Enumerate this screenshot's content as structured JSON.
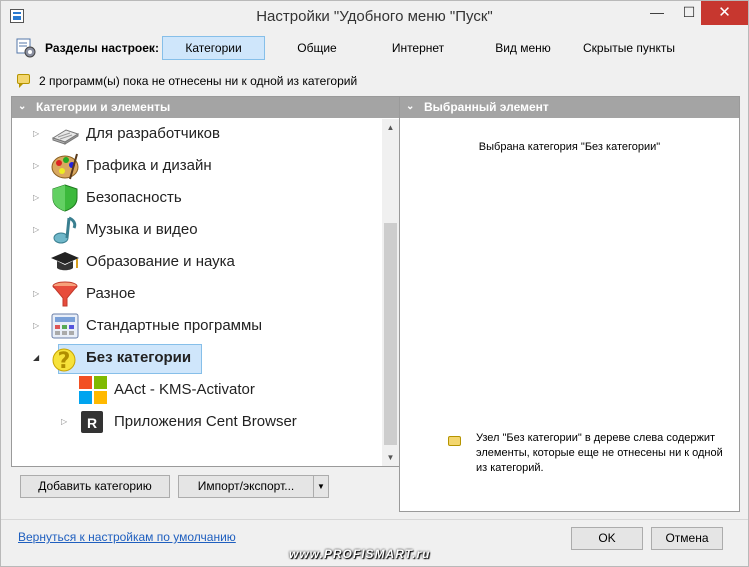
{
  "window": {
    "title": "Настройки \"Удобного меню \"Пуск\"",
    "minimize_label": "—",
    "maximize_label": "☐",
    "close_label": "✕"
  },
  "sections": {
    "label": "Разделы настроек:",
    "tabs": [
      {
        "label": "Категории",
        "active": true
      },
      {
        "label": "Общие",
        "active": false
      },
      {
        "label": "Интернет",
        "active": false
      },
      {
        "label": "Вид меню",
        "active": false
      },
      {
        "label": "Скрытые пункты",
        "active": false
      }
    ]
  },
  "info": {
    "text": "2 программ(ы) пока не отнесены ни к одной из категорий"
  },
  "left_panel": {
    "header": "Категории и элементы",
    "header_chevron": "⌄",
    "tree": [
      {
        "label": "Для разработчиков",
        "icon": "keyboard-icon"
      },
      {
        "label": "Графика и дизайн",
        "icon": "palette-icon"
      },
      {
        "label": "Безопасность",
        "icon": "shield-icon"
      },
      {
        "label": "Музыка и видео",
        "icon": "music-note-icon"
      },
      {
        "label": "Образование и наука",
        "icon": "graduation-cap-icon"
      },
      {
        "label": "Разное",
        "icon": "funnel-icon"
      },
      {
        "label": "Стандартные программы",
        "icon": "calculator-icon"
      },
      {
        "label": "Без категории",
        "icon": "question-mark-icon",
        "selected": true
      },
      {
        "label": "AAct - KMS-Activator",
        "icon": "windows-logo-icon",
        "child": true
      },
      {
        "label": "Приложения Cent Browser",
        "icon": "r-letter-icon",
        "child": true
      }
    ],
    "child_app_letter": "R",
    "category_question_mark": "?",
    "scroll_up": "▲",
    "scroll_down": "▼"
  },
  "buttons": {
    "add_category": "Добавить категорию",
    "import_export": "Импорт/экспорт...",
    "import_export_arrow": "▼",
    "ok": "OK",
    "cancel": "Отмена"
  },
  "right_panel": {
    "header": "Выбранный элемент",
    "header_chevron": "⌄",
    "selected_text": "Выбрана категория \"Без категории\"",
    "hint_text": "Узел \"Без категории\" в дереве слева содержит элементы, которые еще не отнесены ни к одной из категорий."
  },
  "footer": {
    "reset_link": "Вернуться к настройкам по умолчанию",
    "watermark": "www.PROFISMART.ru"
  },
  "colors": {
    "accent": "#cfe6fb",
    "accent_border": "#86bfe9",
    "header_gray": "#a4a4a4",
    "close_red": "#c7372f",
    "link_blue": "#1f5fbf"
  }
}
